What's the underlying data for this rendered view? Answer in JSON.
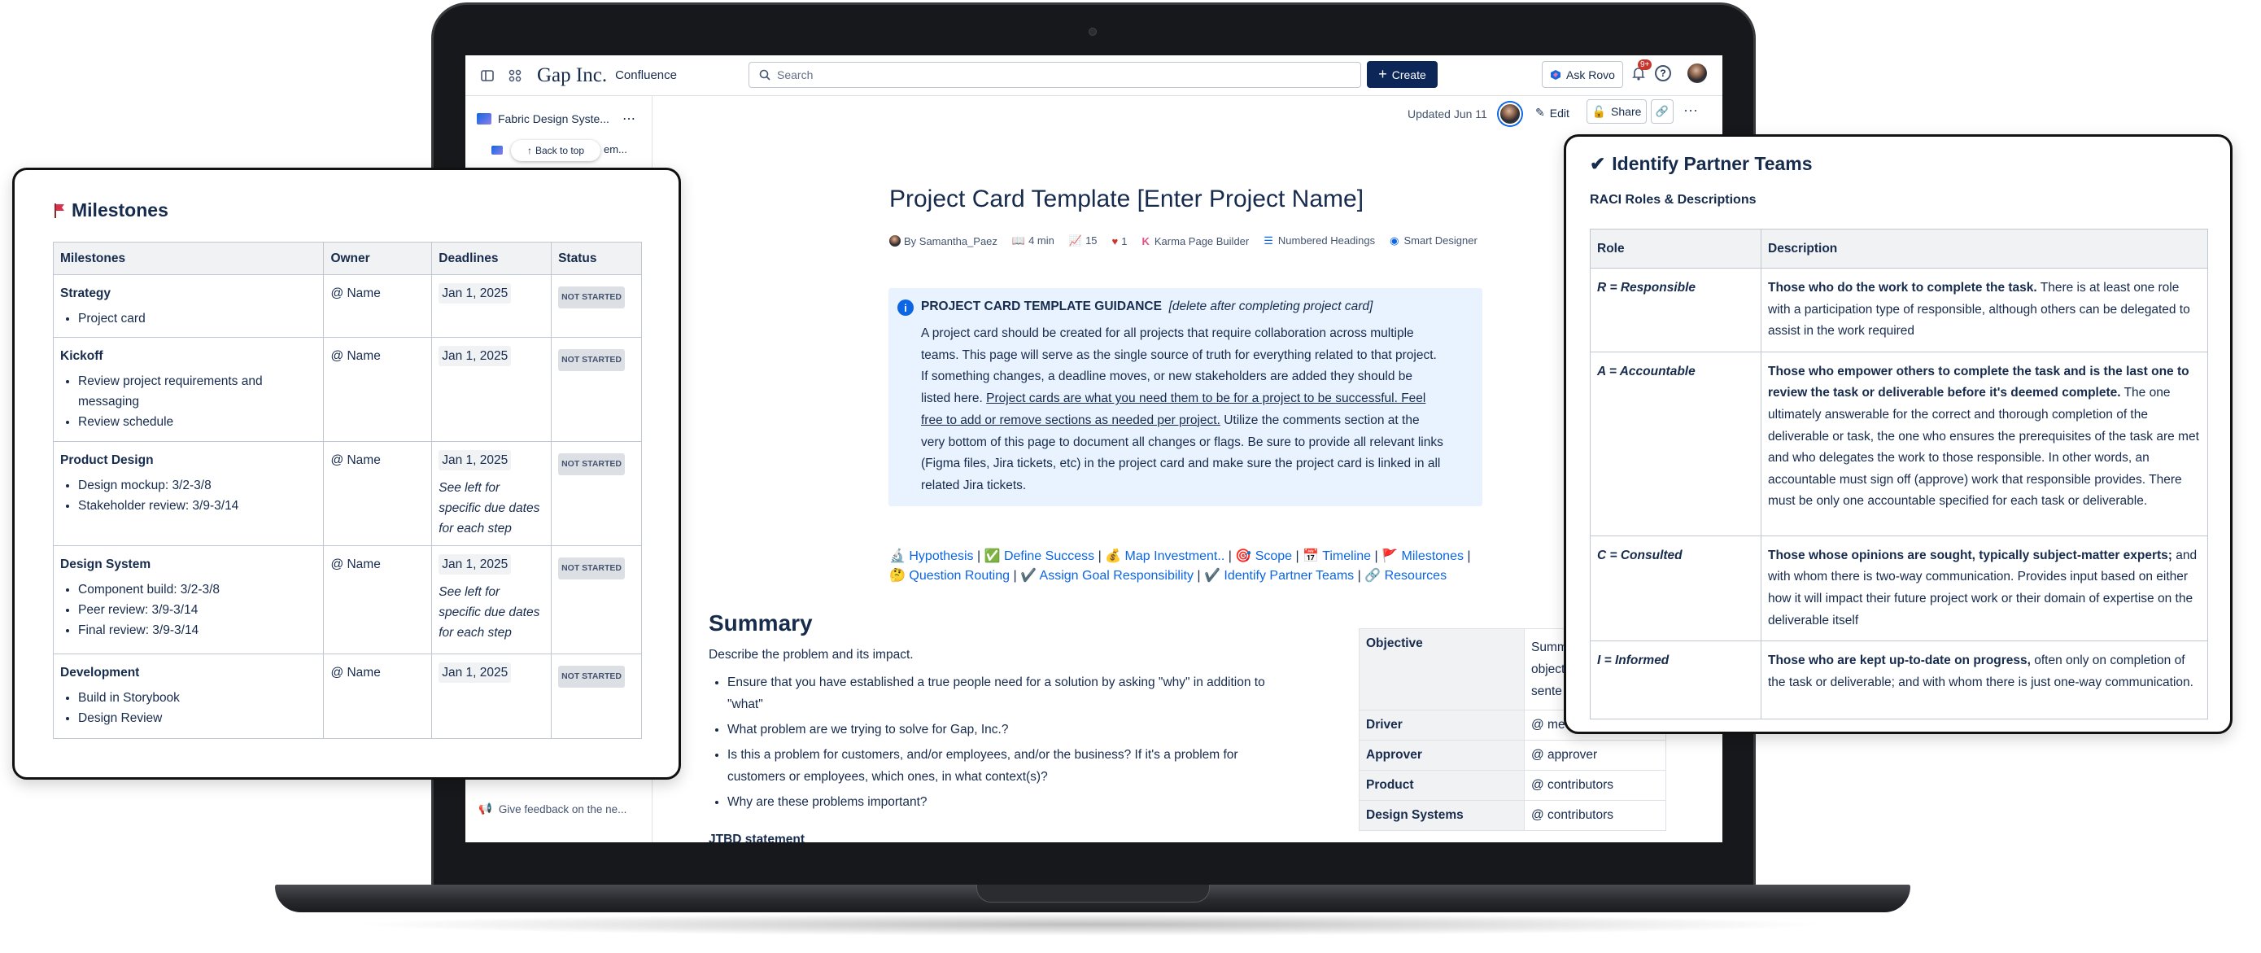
{
  "topbar": {
    "brand": "Gap Inc.",
    "product": "Confluence",
    "search_placeholder": "Search",
    "create": "Create",
    "ask_rovo": "Ask Rovo",
    "notif_badge": "9+",
    "help": "?"
  },
  "sidebar": {
    "space_title": "Fabric Design Syste...",
    "child_title": "em...",
    "back_to_top": "Back to top",
    "feedback": "Give feedback on the ne..."
  },
  "page_header": {
    "updated": "Updated Jun 11",
    "edit": "Edit",
    "share": "Share"
  },
  "page": {
    "title": "Project Card Template [Enter Project Name]",
    "byline": "By Samantha_Paez",
    "read_time": "4 min",
    "views": "15",
    "likes": "1",
    "apps": [
      "Karma Page Builder",
      "Numbered Headings",
      "Smart Designer"
    ]
  },
  "guidance": {
    "title": "PROJECT CARD TEMPLATE GUIDANCE",
    "note": "[delete after completing project card]",
    "lines": [
      "A project card should be created for all projects that require collaboration across multiple",
      "teams. This page will serve as the single source of truth for everything related to that project.",
      "If something changes, a deadline moves, or new stakeholders are added they should be",
      "listed here.",
      "Project cards are what you need them to be for a project to be successful. Feel",
      "free to add or remove sections as needed per project.",
      "Utilize the comments section at the",
      "very bottom of this page to document all changes or flags. Be sure to provide all relevant links",
      "(Figma files, Jira tickets, etc) in the project card and make sure the project card is linked in all",
      "related Jira tickets."
    ]
  },
  "nav_links": [
    {
      "emoji": "🔬",
      "label": "Hypothesis"
    },
    {
      "emoji": "✅",
      "label": "Define Success"
    },
    {
      "emoji": "💰",
      "label": "Map Investment.."
    },
    {
      "emoji": "🎯",
      "label": "Scope"
    },
    {
      "emoji": "📅",
      "label": "Timeline"
    },
    {
      "emoji": "🚩",
      "label": "Milestones"
    },
    {
      "emoji": "🤔",
      "label": "Question Routing"
    },
    {
      "emoji": "✔️",
      "label": "Assign Goal Responsibility"
    },
    {
      "emoji": "✔️",
      "label": "Identify Partner Teams"
    },
    {
      "emoji": "🔗",
      "label": "Resources"
    }
  ],
  "summary": {
    "heading": "Summary",
    "intro": "Describe the problem and its impact.",
    "bullets": [
      [
        "Ensure that you have established a true people need for a solution by asking \"why\" in addition to",
        "\"what\""
      ],
      [
        "What problem are we trying to solve for Gap, Inc.?"
      ],
      [
        "Is this a problem for customers, and/or employees, and/or the business? If it's a problem for",
        "customers or employees, which ones, in what context(s)?"
      ],
      [
        "Why are these problems important?"
      ]
    ],
    "jtbd": "JTBD statement"
  },
  "objective_table": [
    {
      "label": "Objective",
      "value": "Summ\nobject\nsente"
    },
    {
      "label": "Driver",
      "value": "@ me"
    },
    {
      "label": "Approver",
      "value": "@ approver"
    },
    {
      "label": "Product",
      "value": "@ contributors"
    },
    {
      "label": "Design Systems",
      "value": "@ contributors"
    }
  ],
  "milestones": {
    "title": "Milestones",
    "headers": [
      "Milestones",
      "Owner",
      "Deadlines",
      "Status"
    ],
    "rows": [
      {
        "name": "Strategy",
        "items": [
          "Project card"
        ],
        "owner": "@ Name",
        "date": "Jan 1, 2025",
        "note": "",
        "status": "NOT STARTED"
      },
      {
        "name": "Kickoff",
        "items": [
          "Review project requirements and",
          "messaging",
          "Review schedule"
        ],
        "owner": "@ Name",
        "date": "Jan 1, 2025",
        "note": "",
        "status": "NOT STARTED"
      },
      {
        "name": "Product Design",
        "items": [
          "Design mockup: 3/2-3/8",
          "Stakeholder review: 3/9-3/14"
        ],
        "owner": "@ Name",
        "date": "Jan 1, 2025",
        "note": "See left for specific due dates for each step",
        "status": "NOT STARTED"
      },
      {
        "name": "Design System",
        "items": [
          "Component build: 3/2-3/8",
          "Peer review: 3/9-3/14",
          "Final review: 3/9-3/14"
        ],
        "owner": "@ Name",
        "date": "Jan 1, 2025",
        "note": "See left for specific due dates for each step",
        "status": "NOT STARTED"
      },
      {
        "name": "Development",
        "items": [
          "Build in Storybook",
          "Design Review"
        ],
        "owner": "@ Name",
        "date": "Jan 1, 2025",
        "note": "",
        "status": "NOT STARTED"
      }
    ]
  },
  "partners": {
    "title": "Identify Partner Teams",
    "subtitle": "RACI Roles & Descriptions",
    "headers": [
      "Role",
      "Description"
    ],
    "rows": [
      {
        "role": "R = Responsible",
        "bold": "Those who do the work to complete the task.",
        "rest": " There is at least one role with a participation type of responsible, although others can be delegated to assist in the work required"
      },
      {
        "role": "A = Accountable",
        "bold": "Those who empower others to complete the task and is the last one to review the task or deliverable before it's deemed complete.",
        "rest": " The one ultimately answerable for the correct and thorough completion of the deliverable or task, the one who ensures the prerequisites of the task are met and who delegates the work to those responsible. In other words, an accountable must sign off (approve) work that responsible provides. There must be only one accountable specified for each task or deliverable."
      },
      {
        "role": "C = Consulted",
        "bold": "Those whose opinions are sought, typically subject-matter experts;",
        "rest": " and with whom there is two-way communication. Provides input based on either how it will impact their future project work or their domain of expertise on the deliverable itself"
      },
      {
        "role": "I = Informed",
        "bold": "Those who are kept up-to-date on progress,",
        "rest": " often only on completion of the task or deliverable; and with whom there is just one-way communication."
      }
    ]
  }
}
